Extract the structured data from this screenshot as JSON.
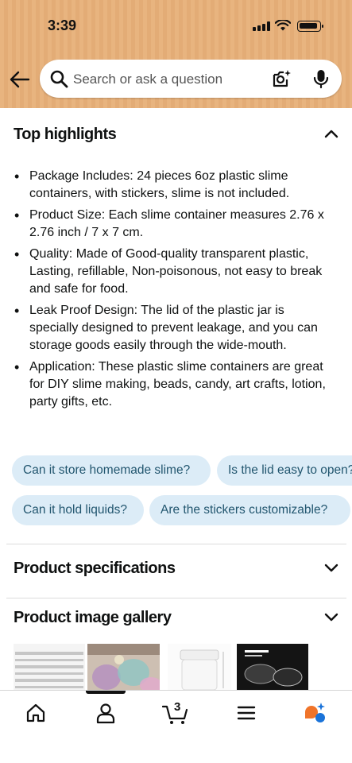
{
  "status_bar": {
    "time": "3:39"
  },
  "search": {
    "placeholder": "Search or ask a question"
  },
  "highlights": {
    "title": "Top highlights",
    "bullets": [
      "Package Includes: 24 pieces 6oz plastic slime containers, with stickers, slime is not included.",
      "Product Size: Each slime container measures 2.76 x 2.76 inch / 7 x 7 cm.",
      "Quality: Made of Good-quality transparent plastic, Lasting, refillable, Non-poisonous, not easy to break and safe for food.",
      "Leak Proof Design: The lid of the plastic jar is specially designed to prevent leakage, and you can storage goods easily through the wide-mouth.",
      "Application: These plastic slime containers are great for DIY slime making, beads, candy, art crafts, lotion, party gifts, etc."
    ]
  },
  "questions": [
    "Can it store homemade slime?",
    "Is the lid easy to open?",
    "Can it hold liquids?",
    "Are the stickers customizable?"
  ],
  "specifications": {
    "title": "Product specifications"
  },
  "gallery": {
    "title": "Product image gallery"
  },
  "bottom_nav": {
    "cart_count": "3"
  },
  "colors": {
    "header": "#e8b47f",
    "chip_bg": "#dcecf7",
    "chip_text": "#22566f",
    "assistant": "#f0742a"
  }
}
